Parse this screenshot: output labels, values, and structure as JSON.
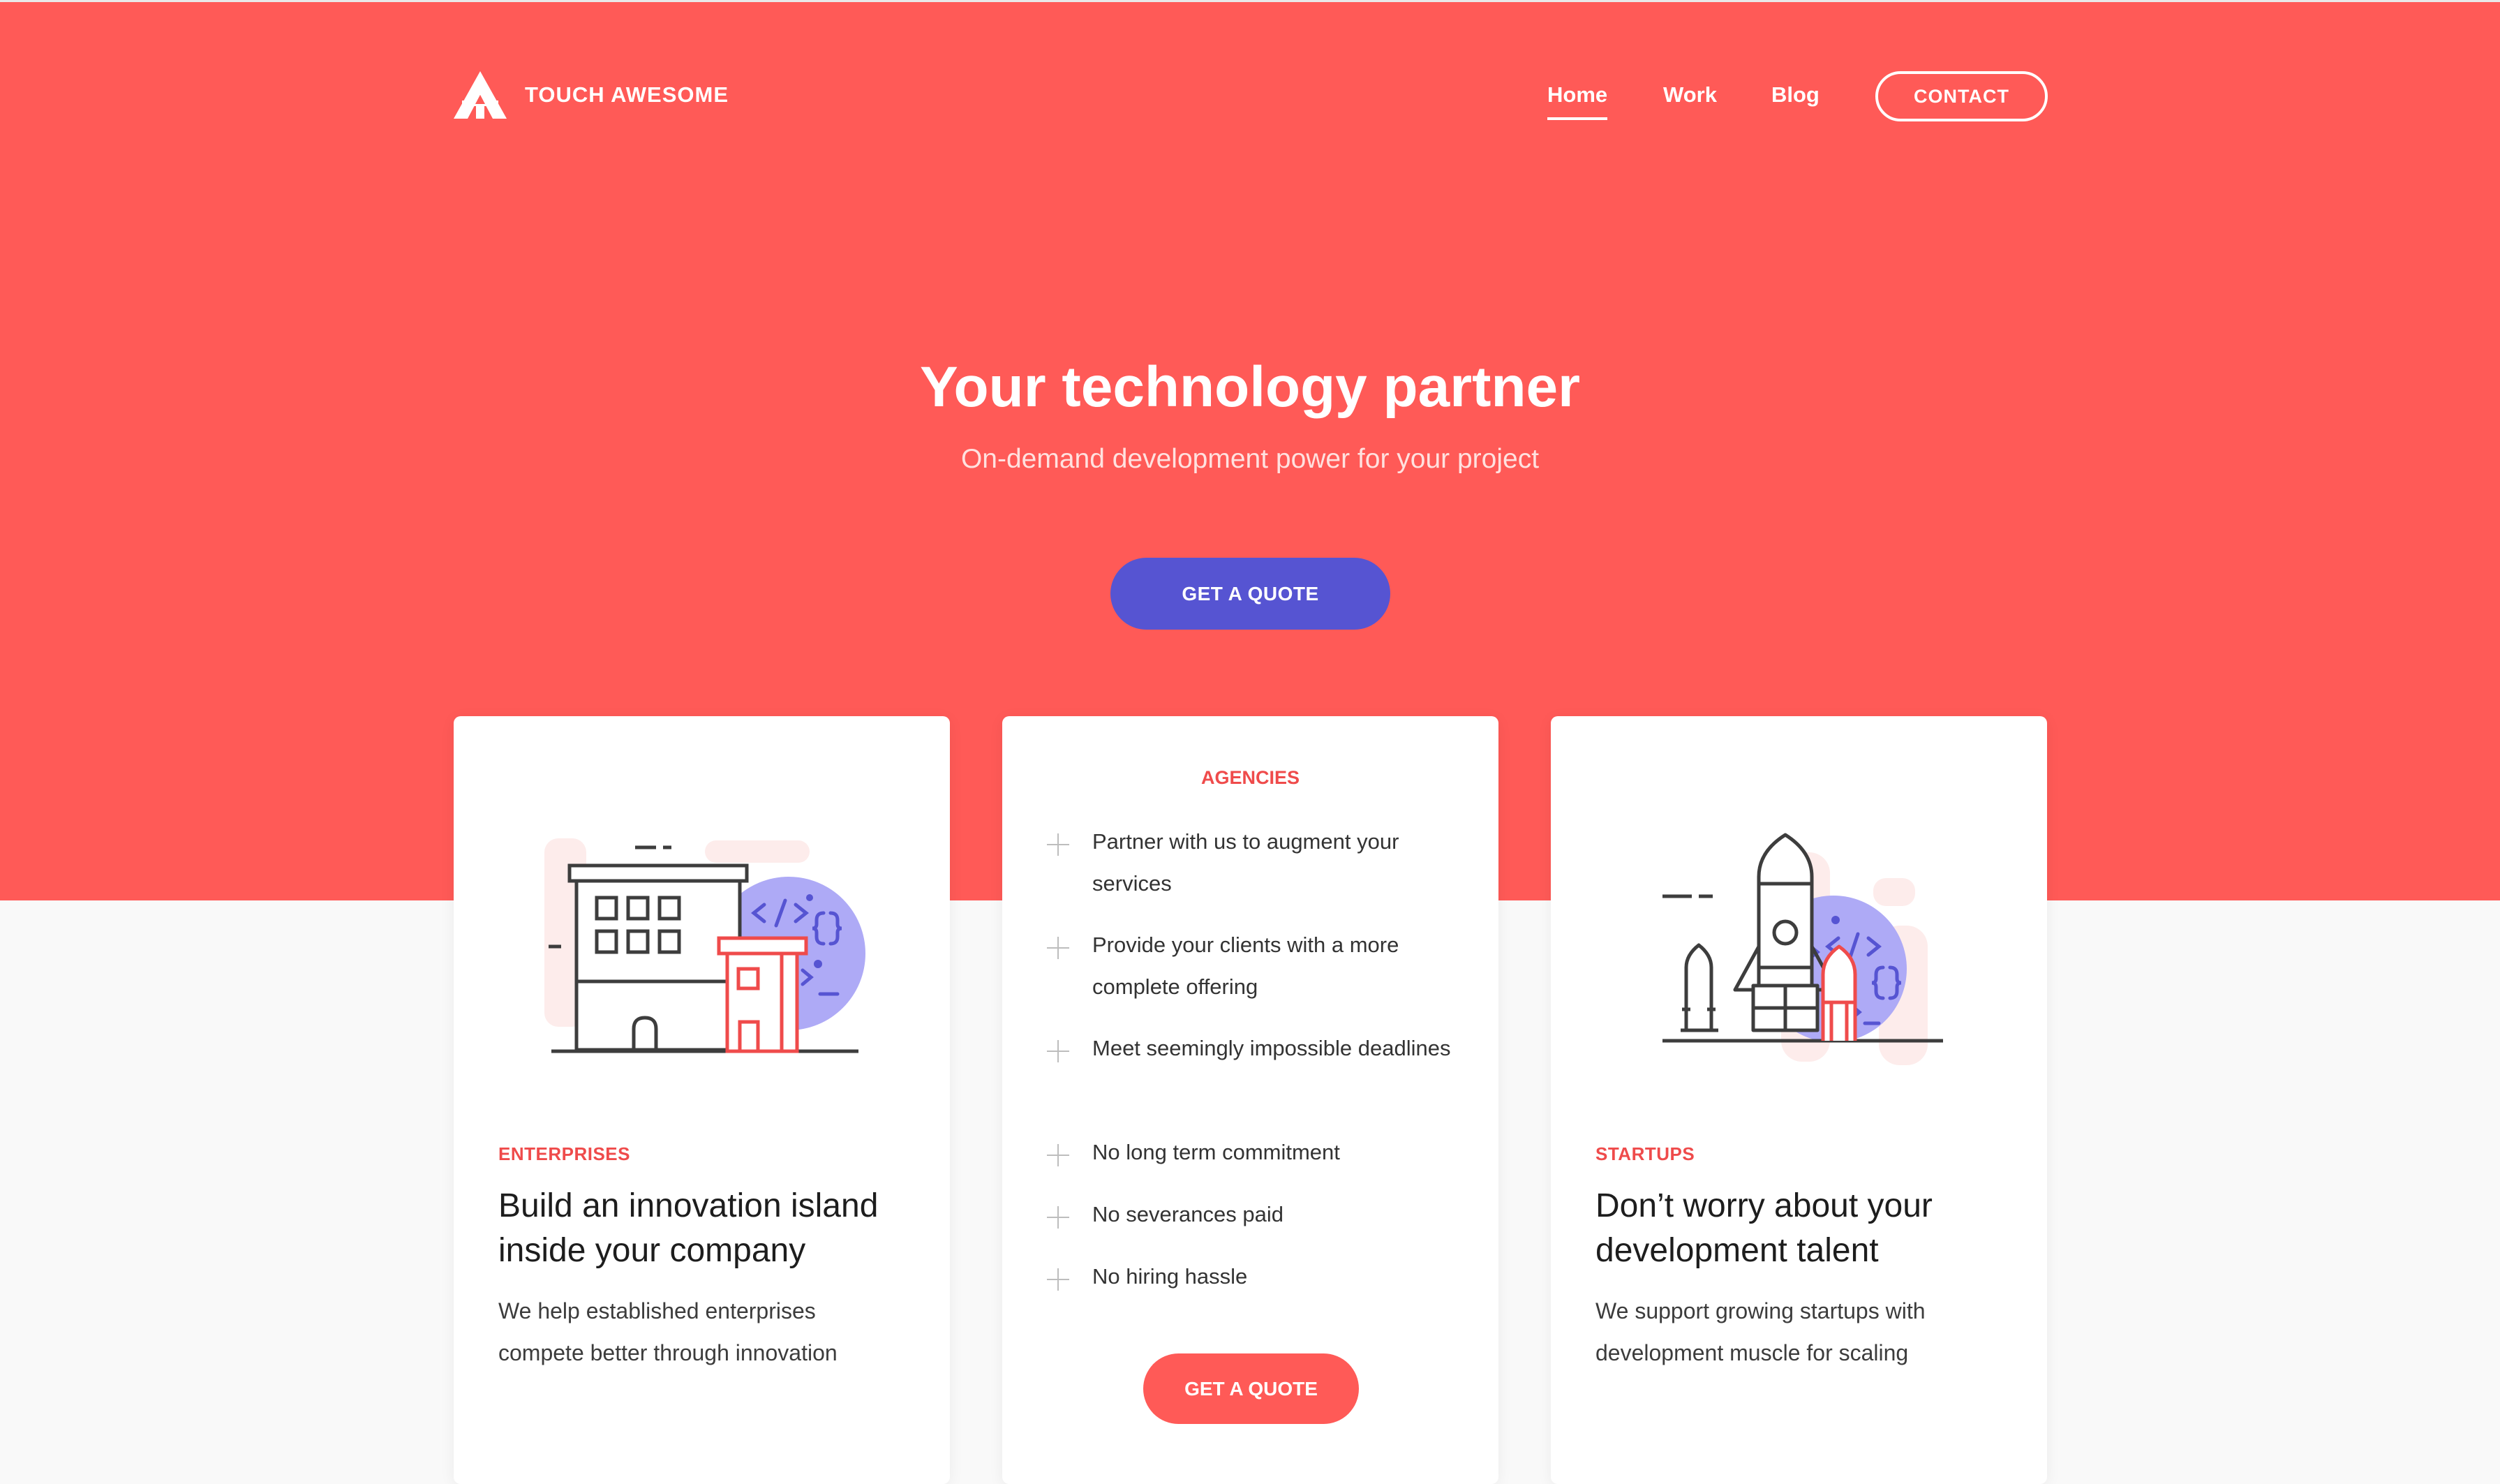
{
  "brand": {
    "name": "TOUCH AWESOME"
  },
  "nav": {
    "links": [
      {
        "label": "Home",
        "active": true
      },
      {
        "label": "Work",
        "active": false
      },
      {
        "label": "Blog",
        "active": false
      }
    ],
    "contact_label": "CONTACT"
  },
  "hero": {
    "title": "Your technology partner",
    "subtitle": "On-demand development power for your project",
    "cta_label": "GET A QUOTE"
  },
  "cards": {
    "enterprises": {
      "tag": "ENTERPRISES",
      "title": "Build an innovation island inside your company",
      "body": "We help established enterprises compete better through innovation",
      "icon": "building-icon"
    },
    "agencies": {
      "tag": "AGENCIES",
      "features": [
        "Partner with us to augment your services",
        "Provide your clients with a more complete offering",
        "Meet seemingly impossible deadlines",
        "No long term commitment",
        "No severances paid",
        "No hiring hassle"
      ],
      "cta_label": "GET A QUOTE"
    },
    "startups": {
      "tag": "STARTUPS",
      "title": "Don’t worry about your development talent",
      "body": "We support growing startups with development muscle for scaling",
      "icon": "rocket-icon"
    }
  },
  "colors": {
    "hero": "#ff5a57",
    "accent_purple": "#5654d2",
    "tag_red": "#ef4b4b",
    "illus_purple": "#a7a3f4"
  }
}
